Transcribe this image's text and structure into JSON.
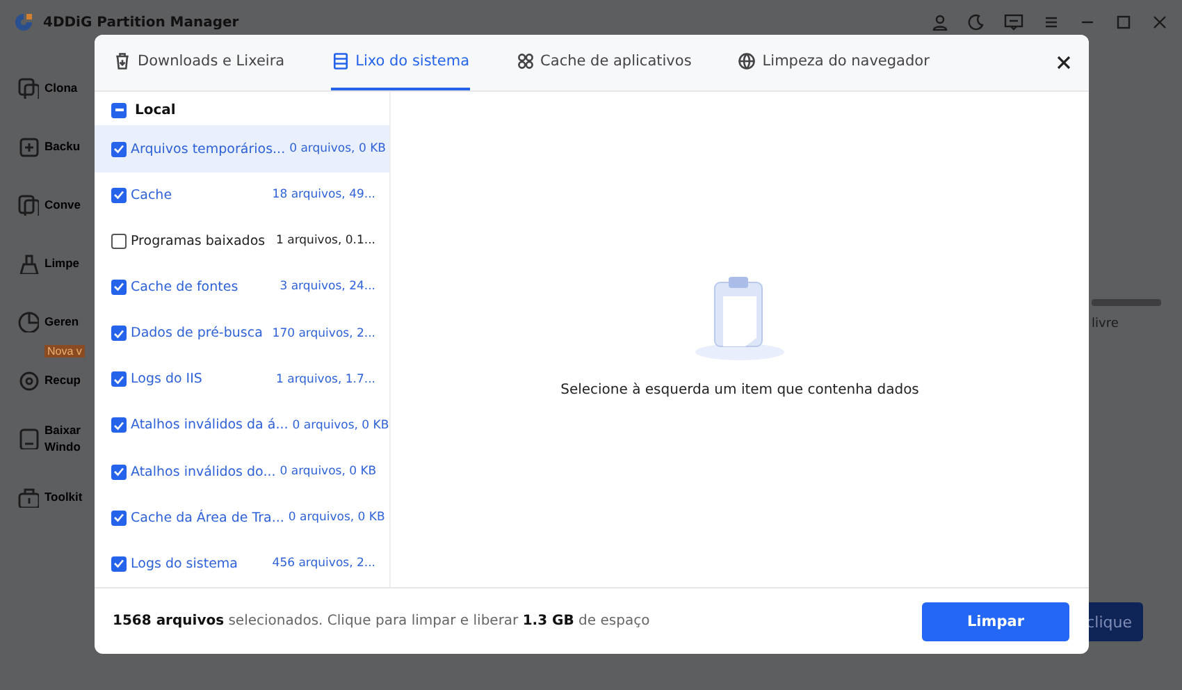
{
  "app": {
    "title": "4DDiG Partition Manager",
    "sidebar": [
      {
        "label": "Clona"
      },
      {
        "label": "Backu"
      },
      {
        "label": "Conve"
      },
      {
        "label": "Limpe"
      },
      {
        "label": "Geren"
      },
      {
        "label": "Recup",
        "badge": "Nova v"
      },
      {
        "label": "Baixar\nWindo"
      },
      {
        "label": "Toolkit"
      }
    ],
    "disk_caption": "livre",
    "action_button": "clique"
  },
  "dialog": {
    "tabs": [
      {
        "label": "Downloads e Lixeira",
        "selected": false
      },
      {
        "label": "Lixo do sistema",
        "selected": true
      },
      {
        "label": "Cache de aplicativos",
        "selected": false
      },
      {
        "label": "Limpeza do navegador",
        "selected": false
      }
    ],
    "group": {
      "label": "Local",
      "indeterminate": true
    },
    "items": [
      {
        "name": "Arquivos temporários...",
        "size": "0 arquivos, 0 KB",
        "checked": true,
        "selected": true
      },
      {
        "name": "Cache",
        "size": "18 arquivos, 49...",
        "checked": true,
        "selected": false
      },
      {
        "name": "Programas baixados",
        "size": "1 arquivos, 0.1...",
        "checked": false,
        "selected": false
      },
      {
        "name": "Cache de fontes",
        "size": "3 arquivos, 24...",
        "checked": true,
        "selected": false
      },
      {
        "name": "Dados de pré-busca",
        "size": "170 arquivos, 2...",
        "checked": true,
        "selected": false
      },
      {
        "name": "Logs do IIS",
        "size": "1 arquivos, 1.7...",
        "checked": true,
        "selected": false
      },
      {
        "name": "Atalhos inválidos da á...",
        "size": "0 arquivos, 0 KB",
        "checked": true,
        "selected": false
      },
      {
        "name": "Atalhos inválidos do...",
        "size": "0 arquivos, 0 KB",
        "checked": true,
        "selected": false
      },
      {
        "name": "Cache da Área de Tra...",
        "size": "0 arquivos, 0 KB",
        "checked": true,
        "selected": false
      },
      {
        "name": "Logs do sistema",
        "size": "456 arquivos, 2...",
        "checked": true,
        "selected": false
      }
    ],
    "empty_message": "Selecione à esquerda um item que contenha dados",
    "summary": "**1568 arquivos** selecionados. Clique para limpar e liberar **1.3 GB** de espaço",
    "button": "Limpar"
  }
}
